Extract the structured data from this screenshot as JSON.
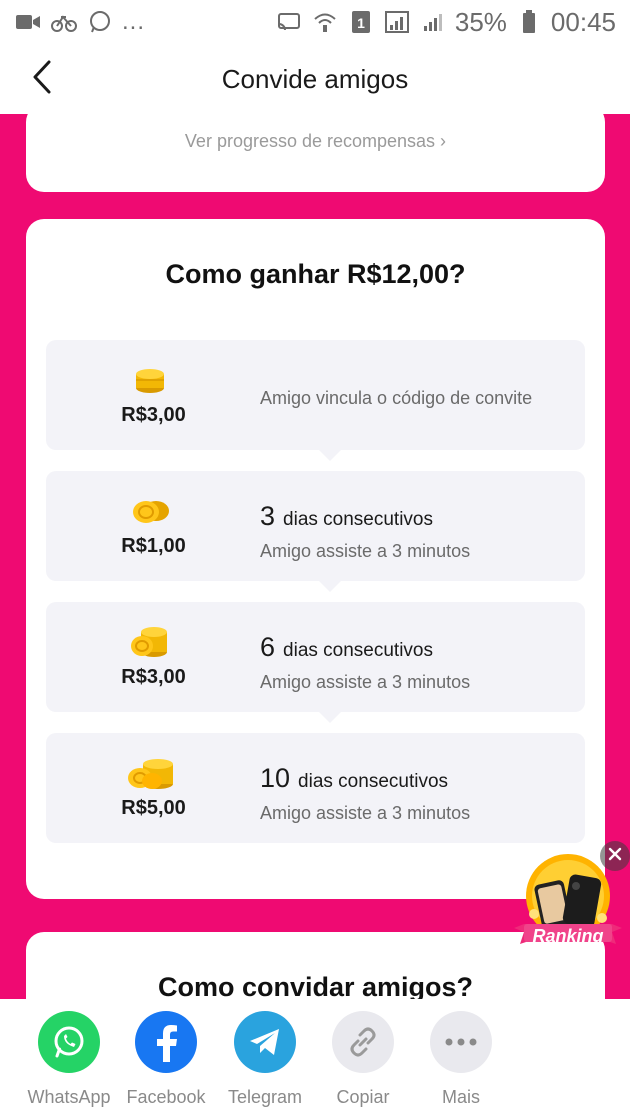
{
  "status_bar": {
    "left_icons": [
      "video-icon",
      "bike-icon",
      "whatsapp-icon"
    ],
    "left_more": "...",
    "right_icons": [
      "cast-icon",
      "wifi-icon",
      "sim1-icon",
      "signal-icon",
      "signal-icon"
    ],
    "battery_percent": "35%",
    "time": "00:45"
  },
  "header": {
    "title": "Convide amigos",
    "back_icon": "chevron-left-icon"
  },
  "colors": {
    "brand_pink": "#ef0a72",
    "card_bg": "#ffffff",
    "step_bg": "#f3f3f8",
    "whatsapp": "#25d366",
    "facebook": "#1877f2",
    "telegram": "#2aa3de",
    "neutral": "#e9e9ee"
  },
  "rewards_card": {
    "progress_link": "Ver progresso de recompensas ›"
  },
  "how_to_earn": {
    "title": "Como ganhar R$12,00?",
    "steps": [
      {
        "amount": "R$3,00",
        "description": "Amigo vincula o código de convite",
        "coin_icon": "coin-stack-icon"
      },
      {
        "amount": "R$1,00",
        "days": "3",
        "days_label": "dias consecutivos",
        "sub": "Amigo assiste a 3 minutos",
        "coin_icon": "coins-icon"
      },
      {
        "amount": "R$3,00",
        "days": "6",
        "days_label": "dias consecutivos",
        "sub": "Amigo assiste a 3 minutos",
        "coin_icon": "coins-icon"
      },
      {
        "amount": "R$5,00",
        "days": "10",
        "days_label": "dias consecutivos",
        "sub": "Amigo assiste a 3 minutos",
        "coin_icon": "coins-icon"
      }
    ]
  },
  "how_to_invite": {
    "title": "Como convidar amigos?"
  },
  "ranking": {
    "label": "Ranking",
    "close_icon": "close-icon"
  },
  "share_bar": {
    "items": [
      {
        "label": "WhatsApp",
        "icon": "whatsapp-icon"
      },
      {
        "label": "Facebook",
        "icon": "facebook-icon"
      },
      {
        "label": "Telegram",
        "icon": "telegram-icon"
      },
      {
        "label": "Copiar",
        "icon": "link-icon"
      },
      {
        "label": "Mais",
        "icon": "more-icon"
      }
    ]
  }
}
